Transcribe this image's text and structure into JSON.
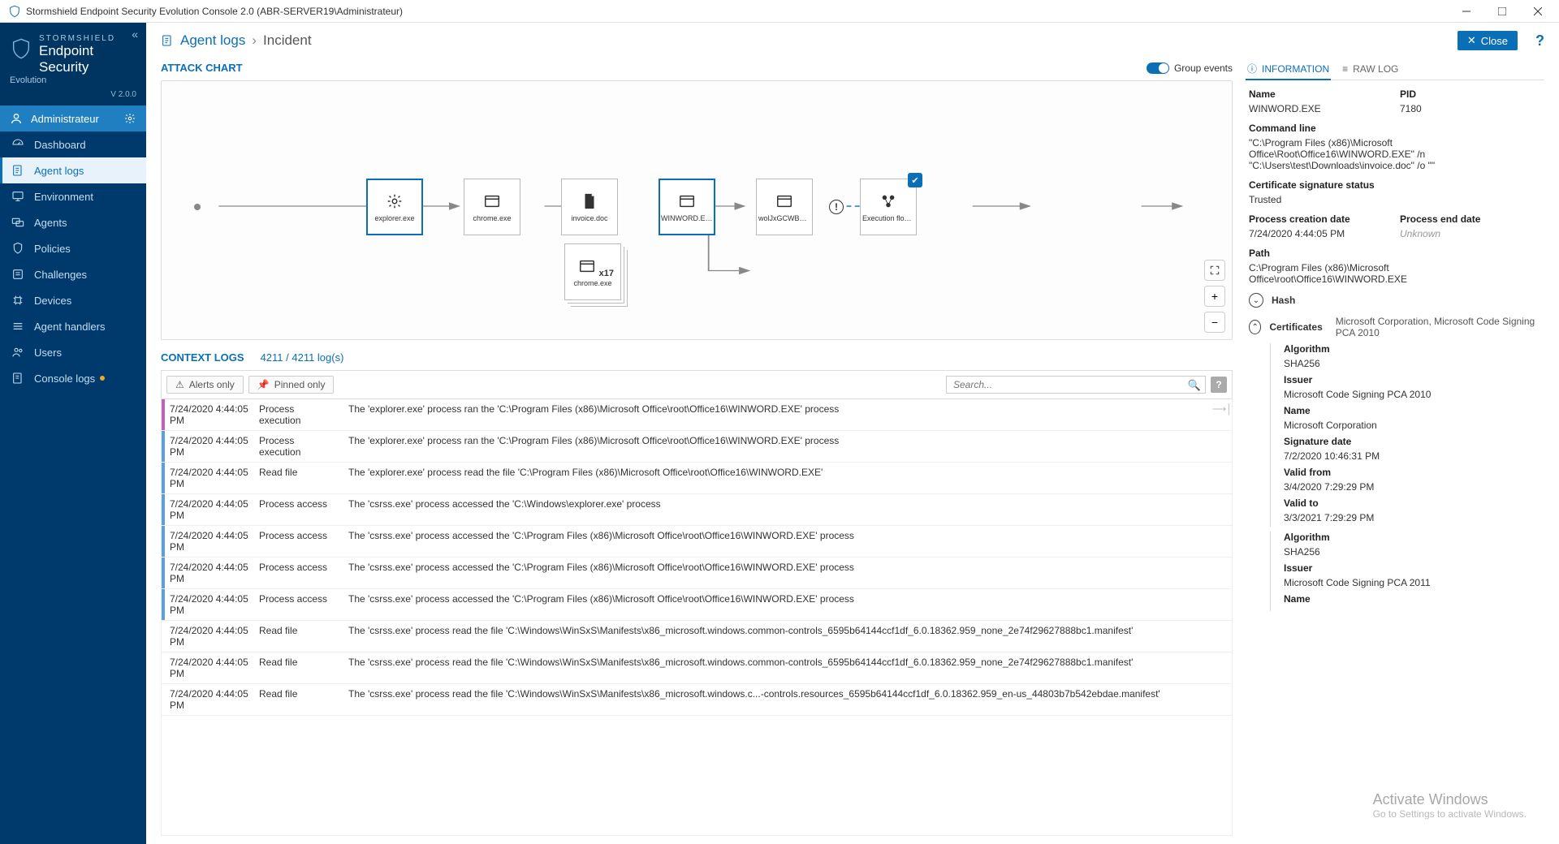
{
  "window": {
    "title": "Stormshield Endpoint Security Evolution Console 2.0 (ABR-SERVER19\\Administrateur)"
  },
  "brand": {
    "line1": "STORMSHIELD",
    "line2": "Endpoint Security",
    "line3": "Evolution",
    "version": "V 2.0.0"
  },
  "admin": "Administrateur",
  "nav": {
    "dashboard": "Dashboard",
    "agent_logs": "Agent logs",
    "environment": "Environment",
    "agents": "Agents",
    "policies": "Policies",
    "challenges": "Challenges",
    "devices": "Devices",
    "agent_handlers": "Agent handlers",
    "users": "Users",
    "console_logs": "Console logs"
  },
  "breadcrumb": {
    "root": "Agent logs",
    "current": "Incident",
    "close": "Close"
  },
  "attack_chart": {
    "title": "ATTACK CHART",
    "group_events": "Group events",
    "nodes": {
      "explorer": "explorer.exe",
      "chrome": "chrome.exe",
      "invoice": "invoice.doc",
      "winword": "WINWORD.EXE",
      "wol": "wolJxGCWBZ.e...",
      "flow": "Execution flow...",
      "chrome2": "chrome.exe",
      "chrome2_count": "x17"
    }
  },
  "context": {
    "title": "CONTEXT LOGS",
    "count": "4211 / 4211 log(s)",
    "alerts_only": "Alerts only",
    "pinned_only": "Pinned only",
    "search_ph": "Search..."
  },
  "logs": [
    {
      "bar": "b1",
      "t": "7/24/2020 4:44:05 PM",
      "a": "Process execution",
      "d": "The 'explorer.exe' process ran the 'C:\\Program Files (x86)\\Microsoft Office\\root\\Office16\\WINWORD.EXE' process",
      "pin": true
    },
    {
      "bar": "b2",
      "t": "7/24/2020 4:44:05 PM",
      "a": "Process execution",
      "d": "The 'explorer.exe' process ran the 'C:\\Program Files (x86)\\Microsoft Office\\root\\Office16\\WINWORD.EXE' process"
    },
    {
      "bar": "b2",
      "t": "7/24/2020 4:44:05 PM",
      "a": "Read file",
      "d": "The 'explorer.exe' process read the file 'C:\\Program Files (x86)\\Microsoft Office\\root\\Office16\\WINWORD.EXE'"
    },
    {
      "bar": "b2",
      "t": "7/24/2020 4:44:05 PM",
      "a": "Process access",
      "d": "The 'csrss.exe' process accessed the 'C:\\Windows\\explorer.exe' process"
    },
    {
      "bar": "b2",
      "t": "7/24/2020 4:44:05 PM",
      "a": "Process access",
      "d": "The 'csrss.exe' process accessed the 'C:\\Program Files (x86)\\Microsoft Office\\root\\Office16\\WINWORD.EXE' process"
    },
    {
      "bar": "b2",
      "t": "7/24/2020 4:44:05 PM",
      "a": "Process access",
      "d": "The 'csrss.exe' process accessed the 'C:\\Program Files (x86)\\Microsoft Office\\root\\Office16\\WINWORD.EXE' process"
    },
    {
      "bar": "b2",
      "t": "7/24/2020 4:44:05 PM",
      "a": "Process access",
      "d": "The 'csrss.exe' process accessed the 'C:\\Program Files (x86)\\Microsoft Office\\root\\Office16\\WINWORD.EXE' process"
    },
    {
      "bar": "",
      "t": "7/24/2020 4:44:05 PM",
      "a": "Read file",
      "d": "The 'csrss.exe' process read the file 'C:\\Windows\\WinSxS\\Manifests\\x86_microsoft.windows.common-controls_6595b64144ccf1df_6.0.18362.959_none_2e74f29627888bc1.manifest'"
    },
    {
      "bar": "",
      "t": "7/24/2020 4:44:05 PM",
      "a": "Read file",
      "d": "The 'csrss.exe' process read the file 'C:\\Windows\\WinSxS\\Manifests\\x86_microsoft.windows.common-controls_6595b64144ccf1df_6.0.18362.959_none_2e74f29627888bc1.manifest'"
    },
    {
      "bar": "",
      "t": "7/24/2020 4:44:05 PM",
      "a": "Read file",
      "d": "The 'csrss.exe' process read the file 'C:\\Windows\\WinSxS\\Manifests\\x86_microsoft.windows.c...-controls.resources_6595b64144ccf1df_6.0.18362.959_en-us_44803b7b542ebdae.manifest'"
    }
  ],
  "tabs": {
    "info": "INFORMATION",
    "raw": "RAW LOG"
  },
  "info": {
    "name_l": "Name",
    "name_v": "WINWORD.EXE",
    "pid_l": "PID",
    "pid_v": "7180",
    "cmd_l": "Command line",
    "cmd_v": "\"C:\\Program Files (x86)\\Microsoft Office\\Root\\Office16\\WINWORD.EXE\" /n \"C:\\Users\\test\\Downloads\\invoice.doc\" /o \"\"",
    "cert_l": "Certificate signature status",
    "cert_v": "Trusted",
    "pc_l": "Process creation date",
    "pc_v": "7/24/2020 4:44:05 PM",
    "pe_l": "Process end date",
    "pe_v": "Unknown",
    "path_l": "Path",
    "path_v": "C:\\Program Files (x86)\\Microsoft Office\\root\\Office16\\WINWORD.EXE",
    "hash_l": "Hash",
    "certs_l": "Certificates",
    "certs_sub": "Microsoft Corporation, Microsoft Code Signing PCA 2010",
    "algo_l": "Algorithm",
    "algo_v": "SHA256",
    "issuer_l": "Issuer",
    "issuer_v": "Microsoft Code Signing PCA 2010",
    "cname_l": "Name",
    "cname_v": "Microsoft Corporation",
    "sig_l": "Signature date",
    "sig_v": "7/2/2020 10:46:31 PM",
    "vf_l": "Valid from",
    "vf_v": "3/4/2020 7:29:29 PM",
    "vt_l": "Valid to",
    "vt_v": "3/3/2021 7:29:29 PM",
    "algo2_v": "SHA256",
    "issuer2_v": "Microsoft Code Signing PCA 2011"
  },
  "watermark": {
    "w1": "Activate Windows",
    "w2": "Go to Settings to activate Windows."
  }
}
